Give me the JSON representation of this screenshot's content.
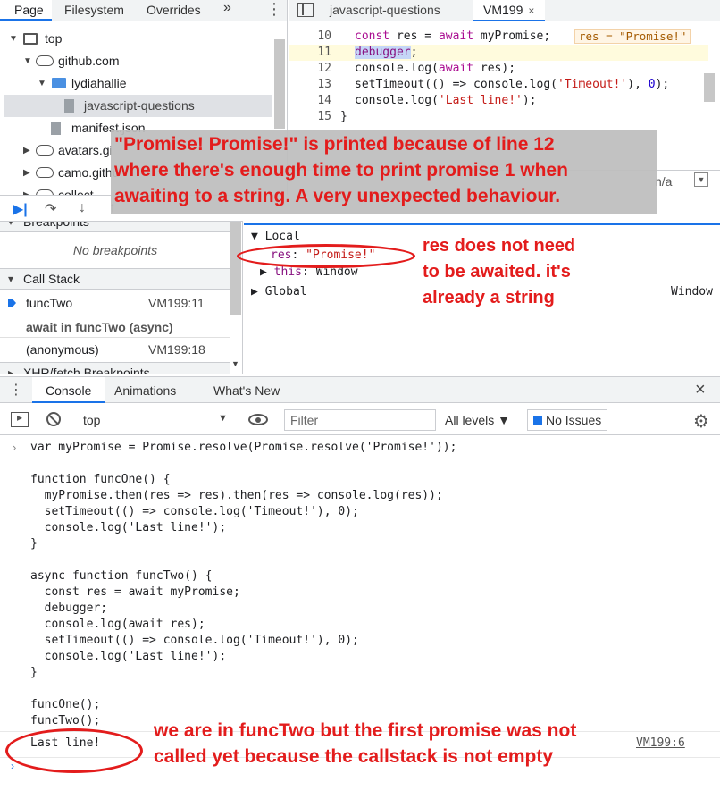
{
  "navigator": {
    "tabs": [
      "Page",
      "Filesystem",
      "Overrides"
    ],
    "more": "»",
    "tree": [
      "top",
      "github.com",
      "lydiahallie",
      "javascript-questions",
      "manifest.json",
      "avatars.gi",
      "camo.githu",
      "collect"
    ]
  },
  "editor": {
    "tab_file1": "javascript-questions",
    "tab_file2": "VM199",
    "close": "×",
    "status_text": "n/a",
    "lines": [
      {
        "num": "10",
        "kw": "const ",
        "text": "res = ",
        "kw2": "await ",
        "rest": "myPromise;"
      },
      {
        "num": "11",
        "dbg": "debugger",
        "rest": ";"
      },
      {
        "num": "12",
        "text": "console.log(",
        "kw": "await ",
        "rest": "res);"
      },
      {
        "num": "13",
        "text": "setTimeout(() => console.log(",
        "str": "'Timeout!'",
        "mid": "), ",
        "numv": "0",
        "rest": ");"
      },
      {
        "num": "14",
        "text": "console.log(",
        "str": "'Last line!'",
        "rest": ");"
      },
      {
        "num": "15",
        "text": "}"
      }
    ],
    "inline_value": "res = \"Promise!\""
  },
  "debugger": {
    "breakpoints_title": "Breakpoints",
    "no_breakpoints": "No breakpoints",
    "call_stack_title": "Call Stack",
    "stack": [
      {
        "name": "funcTwo",
        "loc": "VM199:11"
      },
      {
        "name": "await in funcTwo (async)",
        "loc": ""
      },
      {
        "name": "(anonymous)",
        "loc": "VM199:18"
      }
    ],
    "xhr_title": "XHR/fetch Breakpoints"
  },
  "scope": {
    "local": "Local",
    "res_name": "res",
    "res_value": "\"Promise!\"",
    "this_name": "this",
    "this_value": "Window",
    "global": "Global",
    "global_value": "Window"
  },
  "drawer": {
    "tabs": [
      "Console",
      "Animations",
      "What's New"
    ],
    "close": "×",
    "context": "top",
    "filter_placeholder": "Filter",
    "levels": "All levels ▼",
    "issues": "No Issues"
  },
  "console": {
    "code": [
      "var myPromise = Promise.resolve(Promise.resolve('Promise!'));",
      "",
      "function funcOne() {",
      "  myPromise.then(res => res).then(res => console.log(res));",
      "  setTimeout(() => console.log('Timeout!'), 0);",
      "  console.log('Last line!');",
      "}",
      "",
      "async function funcTwo() {",
      "  const res = await myPromise;",
      "  debugger;",
      "  console.log(await res);",
      "  setTimeout(() => console.log('Timeout!'), 0);",
      "  console.log('Last line!');",
      "}",
      "",
      "funcOne();",
      "funcTwo();"
    ],
    "log_text": "Last line!",
    "log_source": "VM199:6"
  },
  "annotations": {
    "box_text": "\"Promise! Promise!\" is printed because of line 12\nwhere there's enough time to print promise 1 when\nawaiting to a string. A very unexpected behaviour.",
    "res_note": "res does not need\nto be awaited. it's\nalready a string",
    "stack_note": "we are in funcTwo but the first promise was not\ncalled yet because the callstack is not empty",
    "color": "#e31c1c"
  }
}
